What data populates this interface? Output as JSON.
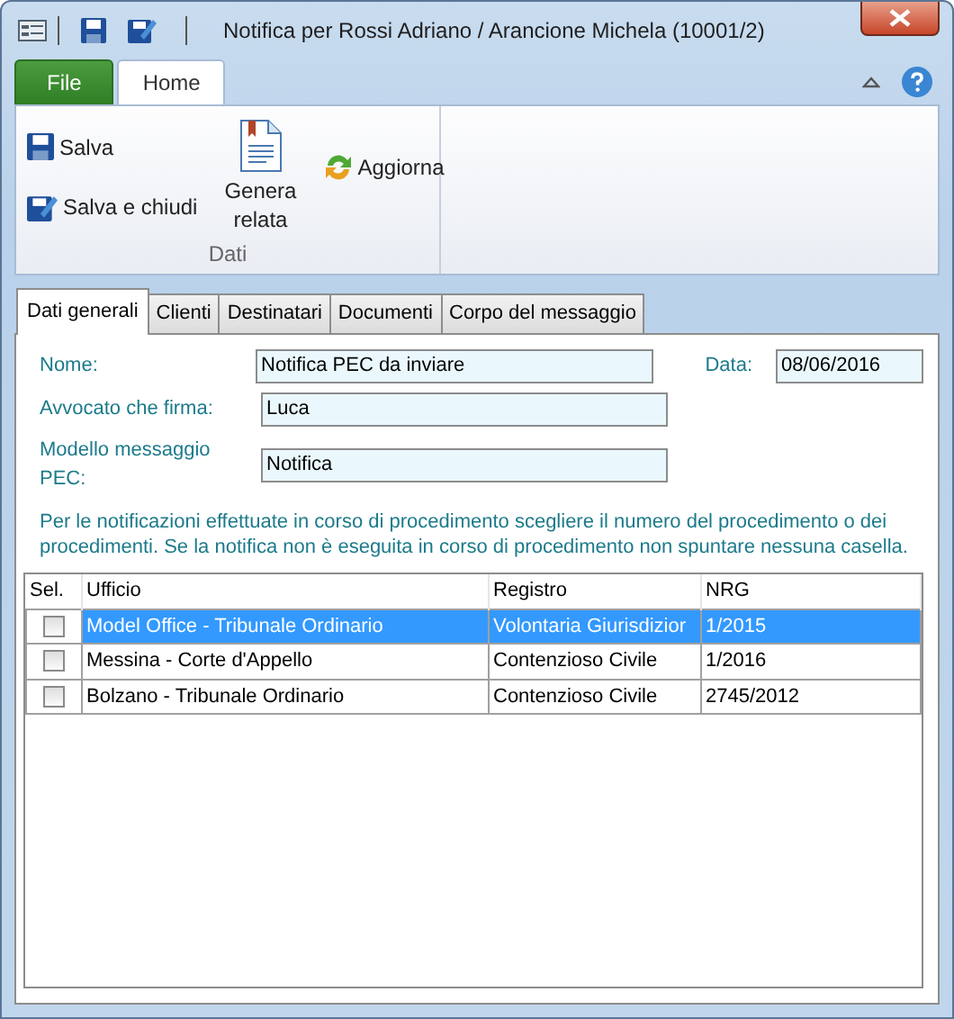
{
  "window": {
    "title": "Notifica per Rossi Adriano / Arancione Michela (10001/2)"
  },
  "ribbon_tabs": [
    {
      "label": "File",
      "kind": "file",
      "selected": false
    },
    {
      "label": "Home",
      "kind": "tab",
      "selected": true
    }
  ],
  "ribbon_group": {
    "label": "Dati",
    "buttons": [
      {
        "label": "Salva",
        "kind": "small"
      },
      {
        "label": "Salva e chiudi",
        "kind": "small"
      },
      {
        "label": "Genera relata",
        "kind": "large"
      },
      {
        "label": "Aggiorna",
        "kind": "small"
      }
    ]
  },
  "form_tabs": [
    {
      "label": "Dati generali",
      "selected": true
    },
    {
      "label": "Clienti",
      "selected": false
    },
    {
      "label": "Destinatari",
      "selected": false
    },
    {
      "label": "Documenti",
      "selected": false
    },
    {
      "label": "Corpo del messaggio",
      "selected": false
    }
  ],
  "fields": [
    {
      "label": "Nome:",
      "value": "Notifica PEC da inviare"
    },
    {
      "label": "Avvocato che firma:",
      "value": "Luca"
    },
    {
      "label": "Modello messaggio PEC:",
      "value": "Notifica"
    }
  ],
  "date": {
    "label": "Data:",
    "value": "08/06/2016"
  },
  "note": "Per le notificazioni effettuate in corso di procedimento scegliere il numero del procedimento o dei procedimenti. Se la notifica non è eseguita in corso di procedimento non spuntare nessuna casella.",
  "table": {
    "selection_column": "Sel.",
    "columns": [
      "Ufficio",
      "Registro",
      "NRG"
    ],
    "rows": [
      {
        "checked": false,
        "selected": true,
        "cells": [
          "Model Office - Tribunale Ordinario",
          "Volontaria Giurisdizior",
          "1/2015"
        ]
      },
      {
        "checked": false,
        "selected": false,
        "cells": [
          "Messina - Corte d'Appello",
          "Contenzioso Civile",
          "1/2016"
        ]
      },
      {
        "checked": false,
        "selected": false,
        "cells": [
          "Bolzano - Tribunale Ordinario",
          "Contenzioso Civile",
          "2745/2012"
        ]
      }
    ]
  }
}
